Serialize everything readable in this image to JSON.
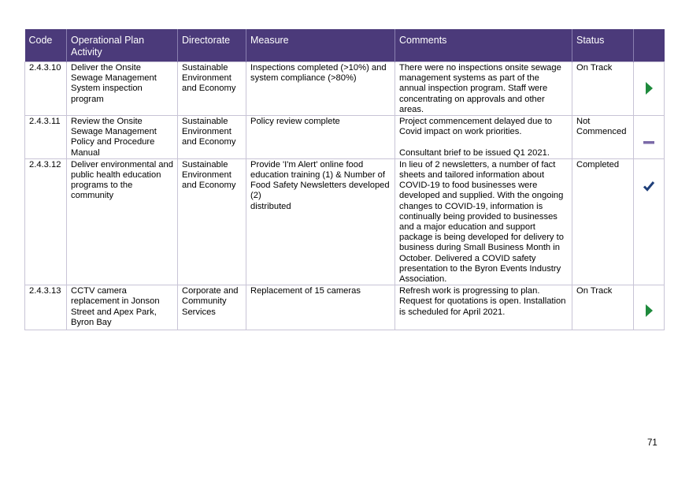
{
  "table": {
    "headers": {
      "code": "Code",
      "activity": "Operational Plan Activity",
      "directorate": "Directorate",
      "measure": "Measure",
      "comments": "Comments",
      "status": "Status"
    },
    "rows": [
      {
        "code": "2.4.3.10",
        "activity": "Deliver the Onsite Sewage Management System inspection program",
        "directorate": "Sustainable Environment and Economy",
        "measure": "Inspections completed (>10%) and system compliance (>80%)",
        "comments": "There were no inspections onsite sewage management systems as part of the annual inspection program. Staff were concentrating on approvals and other areas.",
        "status": "On Track",
        "status_icon": "play-arrow-icon",
        "status_color": "#1e8a3c"
      },
      {
        "code": "2.4.3.11",
        "activity": "Review the Onsite Sewage Management Policy and Procedure Manual",
        "directorate": "Sustainable Environment and Economy",
        "measure": "Policy review complete",
        "comments": "Project commencement delayed due to Covid impact on work priorities.\n\nConsultant brief to be issued Q1 2021.",
        "status": "Not Commenced",
        "status_icon": "dash-icon",
        "status_color": "#7b6aa8"
      },
      {
        "code": "2.4.3.12",
        "activity": "Deliver environmental and public health education programs to the community",
        "directorate": "Sustainable Environment and Economy",
        "measure": "Provide 'I'm Alert' online food education training (1) & Number of Food Safety Newsletters developed (2)\ndistributed",
        "comments": "In lieu of 2 newsletters, a number of fact sheets and tailored information about COVID-19 to food businesses were developed and supplied. With the ongoing changes to COVID-19, information is continually being provided to businesses and a major education and support package is being developed for delivery to business during Small Business Month in October.  Delivered a COVID safety presentation to the Byron Events Industry Association.",
        "status": "Completed",
        "status_icon": "checkmark-icon",
        "status_color": "#1f3f7a"
      },
      {
        "code": "2.4.3.13",
        "activity": "CCTV camera replacement in Jonson Street and Apex Park, Byron Bay",
        "directorate": "Corporate and Community Services",
        "measure": "Replacement of 15 cameras",
        "comments": "Refresh work is progressing to plan. Request for quotations is open. Installation is scheduled for April 2021.",
        "status": "On Track",
        "status_icon": "play-arrow-icon",
        "status_color": "#1e8a3c"
      }
    ]
  },
  "page_number": "71"
}
